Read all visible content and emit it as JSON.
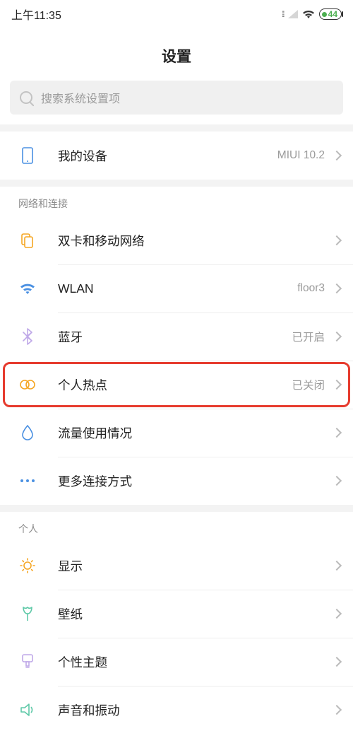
{
  "status": {
    "time": "上午11:35",
    "battery": "44"
  },
  "title": "设置",
  "search": {
    "placeholder": "搜索系统设置项"
  },
  "device": {
    "label": "我的设备",
    "value": "MIUI 10.2"
  },
  "sections": {
    "network": {
      "header": "网络和连接",
      "items": [
        {
          "label": "双卡和移动网络",
          "value": ""
        },
        {
          "label": "WLAN",
          "value": "floor3"
        },
        {
          "label": "蓝牙",
          "value": "已开启"
        },
        {
          "label": "个人热点",
          "value": "已关闭"
        },
        {
          "label": "流量使用情况",
          "value": ""
        },
        {
          "label": "更多连接方式",
          "value": ""
        }
      ]
    },
    "personal": {
      "header": "个人",
      "items": [
        {
          "label": "显示"
        },
        {
          "label": "壁纸"
        },
        {
          "label": "个性主题"
        },
        {
          "label": "声音和振动"
        }
      ]
    }
  }
}
